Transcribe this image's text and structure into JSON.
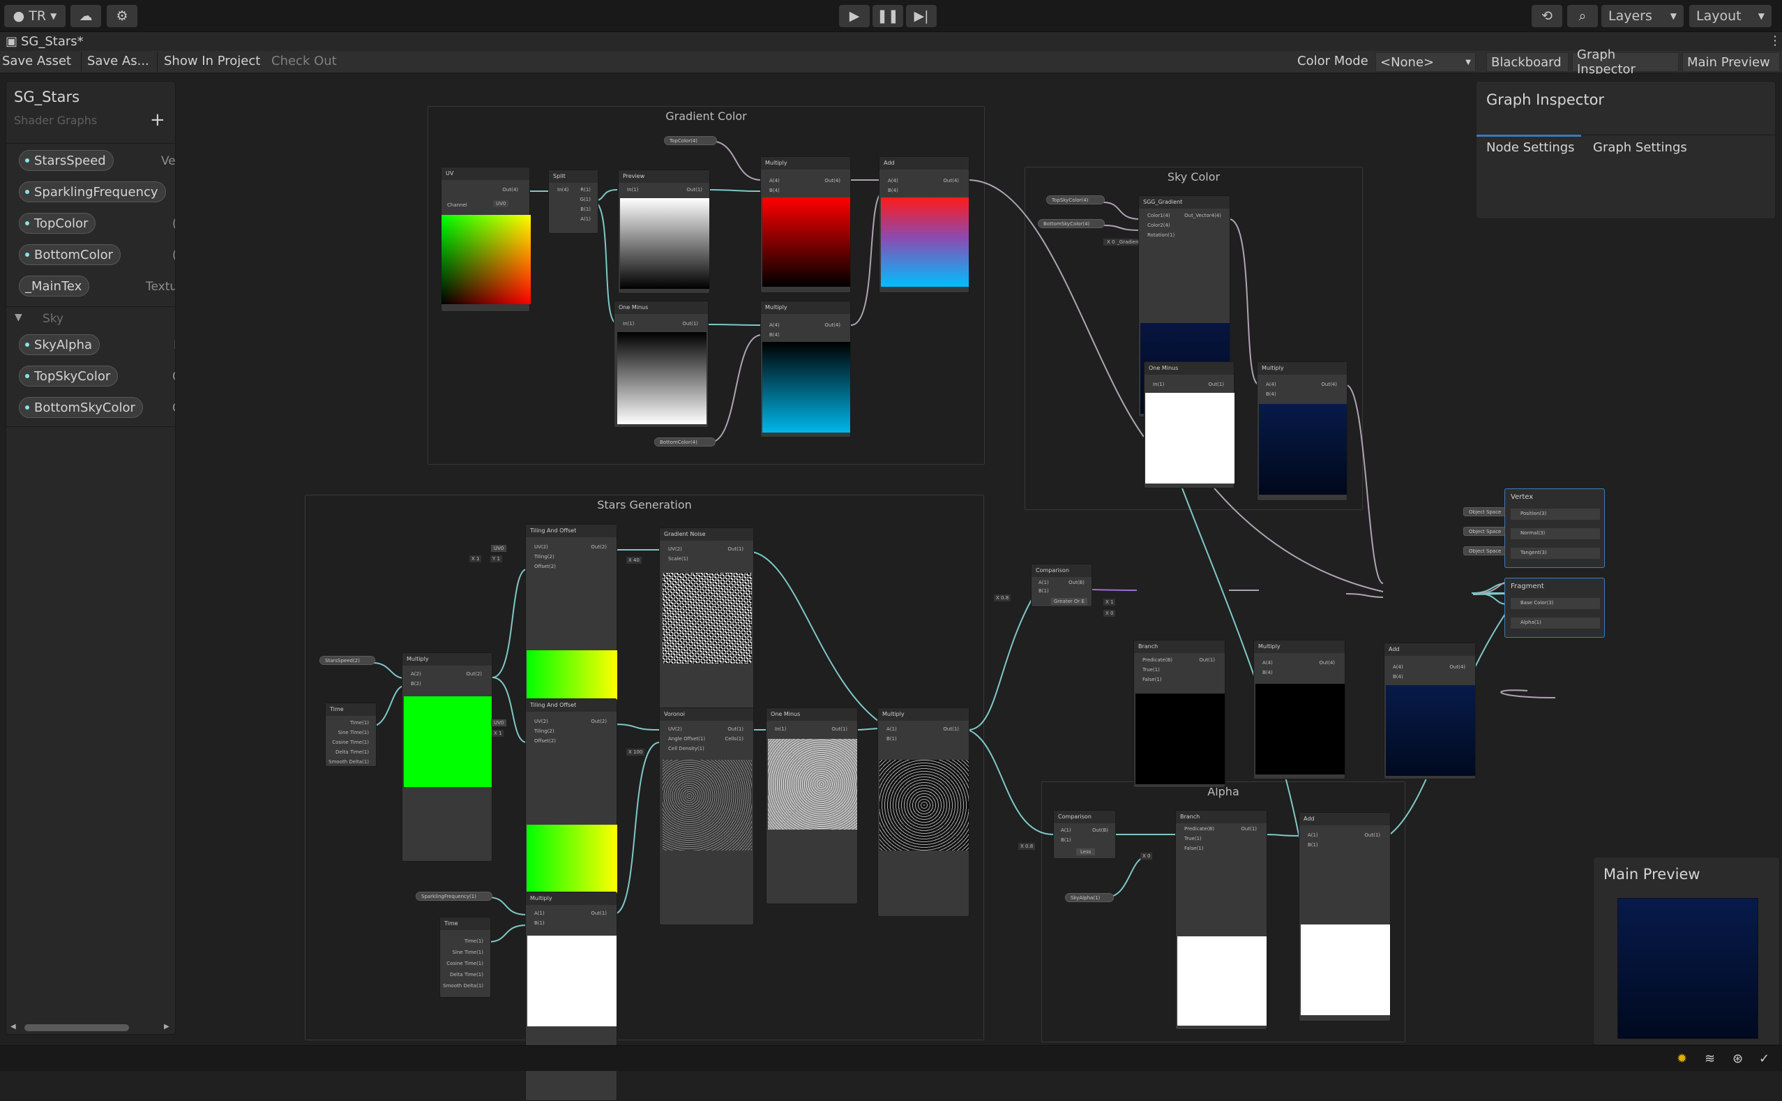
{
  "topbar": {
    "account_label": "TR",
    "layers_label": "Layers",
    "layout_label": "Layout"
  },
  "window": {
    "tab_title": "SG_Stars*"
  },
  "toolbar": {
    "save_asset": "Save Asset",
    "save_as": "Save As...",
    "show_in_project": "Show In Project",
    "check_out": "Check Out",
    "color_mode_label": "Color Mode",
    "color_mode_value": "<None>",
    "blackboard": "Blackboard",
    "graph_inspector": "Graph Inspector",
    "main_preview": "Main Preview"
  },
  "blackboard": {
    "title": "SG_Stars",
    "subtitle": "Shader Graphs",
    "add": "+",
    "properties": [
      {
        "name": "StarsSpeed",
        "type": "Ve"
      },
      {
        "name": "SparklingFrequency",
        "type": ""
      },
      {
        "name": "TopColor",
        "type": "("
      },
      {
        "name": "BottomColor",
        "type": "("
      },
      {
        "name": "_MainTex",
        "type": "Textu"
      }
    ],
    "category": "Sky",
    "category_properties": [
      {
        "name": "SkyAlpha",
        "type": "I"
      },
      {
        "name": "TopSkyColor",
        "type": "C"
      },
      {
        "name": "BottomSkyColor",
        "type": "C"
      }
    ]
  },
  "groups": {
    "gradient_color": "Gradient Color",
    "sky_color": "Sky Color",
    "stars_generation": "Stars  Generation",
    "alpha": "Alpha"
  },
  "nodes": {
    "uv": {
      "title": "UV",
      "out": "Out(4)",
      "channel_label": "Channel",
      "channel_value": "UV0"
    },
    "split": {
      "title": "Split",
      "in": "In(4)",
      "outs": [
        "R(1)",
        "G(1)",
        "B(1)",
        "A(1)"
      ]
    },
    "preview": {
      "title": "Preview",
      "in": "In(1)",
      "out": "Out(1)"
    },
    "multiply_g1": {
      "title": "Multiply",
      "ins": [
        "A(4)",
        "B(4)"
      ],
      "out": "Out(4)"
    },
    "add_g1": {
      "title": "Add",
      "ins": [
        "A(4)",
        "B(4)"
      ],
      "out": "Out(4)"
    },
    "one_minus_g1": {
      "title": "One Minus",
      "in": "In(1)",
      "out": "Out(1)"
    },
    "multiply_g2": {
      "title": "Multiply",
      "ins": [
        "A(4)",
        "B(4)"
      ],
      "out": "Out(4)"
    },
    "topcolor_pill": "TopColor(4)",
    "bottomcolor_pill": "BottomColor(4)",
    "sg_gradient": {
      "title": "SGG_Gradient",
      "ins": [
        "Color1(4)",
        "Color2(4)",
        "Rotation(1)"
      ],
      "out": "Out_Vector4(4)"
    },
    "topskycolor_pill": "TopSkyColor(4)",
    "bottomskycolor_pill": "BottomSkyColor(4)",
    "rotation_val": "X 0",
    "one_minus_sky": {
      "title": "One Minus",
      "in": "In(1)",
      "out": "Out(1)"
    },
    "multiply_sky": {
      "title": "Multiply",
      "ins": [
        "A(4)",
        "B(4)"
      ],
      "out": "Out(4)"
    },
    "tiling1": {
      "title": "Tiling And Offset",
      "ins": [
        "UV(2)",
        "Tiling(2)",
        "Offset(2)"
      ],
      "out": "Out(2)",
      "uv": "UV0",
      "tiling_x": "X 1",
      "tiling_y": "Y 1"
    },
    "gradient_noise": {
      "title": "Gradient Noise",
      "ins": [
        "UV(2)",
        "Scale(1)"
      ],
      "out": "Out(1)",
      "scale": "X 40"
    },
    "starsspeed_pill": "StarsSpeed(2)",
    "multiply_speed": {
      "title": "Multiply",
      "ins": [
        "A(2)",
        "B(2)"
      ],
      "out": "Out(2)"
    },
    "time1": {
      "title": "Time",
      "outs": [
        "Time(1)",
        "Sine Time(1)",
        "Cosine Time(1)",
        "Delta Time(1)",
        "Smooth Delta(1)"
      ]
    },
    "tiling2": {
      "title": "Tiling And Offset",
      "ins": [
        "UV(2)",
        "Tiling(2)",
        "Offset(2)"
      ],
      "out": "Out(2)",
      "uv": "UV0",
      "tiling_x": "X 1"
    },
    "voronoi": {
      "title": "Voronoi",
      "ins": [
        "UV(2)",
        "Angle Offset(1)",
        "Cell Density(1)"
      ],
      "outs": [
        "Out(1)",
        "Cells(1)"
      ],
      "density": "X 100"
    },
    "one_minus_stars": {
      "title": "One Minus",
      "in": "In(1)",
      "out": "Out(1)"
    },
    "multiply_stars": {
      "title": "Multiply",
      "ins": [
        "A(1)",
        "B(1)"
      ],
      "out": "Out(1)"
    },
    "sparkling_pill": "SparklingFrequency(1)",
    "multiply_spark": {
      "title": "Multiply",
      "ins": [
        "A(1)",
        "B(1)"
      ],
      "out": "Out(1)"
    },
    "time2": {
      "title": "Time",
      "outs": [
        "Time(1)",
        "Sine Time(1)",
        "Cosine Time(1)",
        "Delta Time(1)",
        "Smooth Delta(1)"
      ]
    },
    "comparison1": {
      "title": "Comparison",
      "ins": [
        "A(1)",
        "B(1)"
      ],
      "out": "Out(B)",
      "b_val": "X 0.8",
      "mode": "Greater Or E"
    },
    "branch1": {
      "title": "Branch",
      "ins": [
        "Predicate(B)",
        "True(1)",
        "False(1)"
      ],
      "out": "Out(1)",
      "true_val": "X 1",
      "false_val": "X 0"
    },
    "multiply_br": {
      "title": "Multiply",
      "ins": [
        "A(4)",
        "B(4)"
      ],
      "out": "Out(4)"
    },
    "add_final": {
      "title": "Add",
      "ins": [
        "A(4)",
        "B(4)"
      ],
      "out": "Out(4)"
    },
    "comparison2": {
      "title": "Comparison",
      "ins": [
        "A(1)",
        "B(1)"
      ],
      "out": "Out(B)",
      "b_val": "X 0.8",
      "mode": "Less"
    },
    "branch2": {
      "title": "Branch",
      "ins": [
        "Predicate(B)",
        "True(1)",
        "False(1)"
      ],
      "out": "Out(1)",
      "false_val": "X 0"
    },
    "add_alpha": {
      "title": "Add",
      "ins": [
        "A(1)",
        "B(1)"
      ],
      "out": "Out(1)"
    },
    "skyalpha_pill": "SkyAlpha(1)"
  },
  "vertex": {
    "title": "Vertex",
    "ports": [
      "Position(3)",
      "Normal(3)",
      "Tangent(3)"
    ],
    "space": "Object Space"
  },
  "fragment": {
    "title": "Fragment",
    "ports": [
      "Base Color(3)",
      "Alpha(1)"
    ]
  },
  "graph_inspector": {
    "title": "Graph Inspector",
    "tabs": [
      "Node Settings",
      "Graph Settings"
    ]
  },
  "main_preview": {
    "title": "Main Preview"
  }
}
